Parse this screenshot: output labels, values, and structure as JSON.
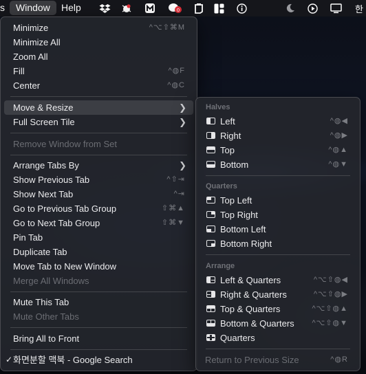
{
  "menubar": {
    "cut_item": "s",
    "window": "Window",
    "help": "Help",
    "ime": "한"
  },
  "window_menu": {
    "items": [
      {
        "label": "Minimize",
        "shortcut": "^⌥⇧⌘M"
      },
      {
        "label": "Minimize All",
        "shortcut": ""
      },
      {
        "label": "Zoom All",
        "shortcut": ""
      },
      {
        "label": "Fill",
        "shortcut": "^◍F"
      },
      {
        "label": "Center",
        "shortcut": "^◍C"
      },
      {
        "label": "Move & Resize",
        "shortcut": ""
      },
      {
        "label": "Full Screen Tile",
        "shortcut": ""
      },
      {
        "label": "Remove Window from Set",
        "shortcut": ""
      },
      {
        "label": "Arrange Tabs By",
        "shortcut": ""
      },
      {
        "label": "Show Previous Tab",
        "shortcut": "^⇧⇥"
      },
      {
        "label": "Show Next Tab",
        "shortcut": "^⇥"
      },
      {
        "label": "Go to Previous Tab Group",
        "shortcut": "⇧⌘▲"
      },
      {
        "label": "Go to Next Tab Group",
        "shortcut": "⇧⌘▼"
      },
      {
        "label": "Pin Tab",
        "shortcut": ""
      },
      {
        "label": "Duplicate Tab",
        "shortcut": ""
      },
      {
        "label": "Move Tab to New Window",
        "shortcut": ""
      },
      {
        "label": "Merge All Windows",
        "shortcut": ""
      },
      {
        "label": "Mute This Tab",
        "shortcut": ""
      },
      {
        "label": "Mute Other Tabs",
        "shortcut": ""
      },
      {
        "label": "Bring All to Front",
        "shortcut": ""
      },
      {
        "label": "화면분할 맥북 - Google Search",
        "shortcut": ""
      }
    ]
  },
  "submenu": {
    "halves_header": "Halves",
    "quarters_header": "Quarters",
    "arrange_header": "Arrange",
    "halves": [
      {
        "label": "Left",
        "shortcut": "^◍◀"
      },
      {
        "label": "Right",
        "shortcut": "^◍▶"
      },
      {
        "label": "Top",
        "shortcut": "^◍▲"
      },
      {
        "label": "Bottom",
        "shortcut": "^◍▼"
      }
    ],
    "quarters": [
      {
        "label": "Top Left"
      },
      {
        "label": "Top Right"
      },
      {
        "label": "Bottom Left"
      },
      {
        "label": "Bottom Right"
      }
    ],
    "arrange": [
      {
        "label": "Left & Quarters",
        "shortcut": "^⌥⇧◍◀"
      },
      {
        "label": "Right & Quarters",
        "shortcut": "^⌥⇧◍▶"
      },
      {
        "label": "Top & Quarters",
        "shortcut": "^⌥⇧◍▲"
      },
      {
        "label": "Bottom & Quarters",
        "shortcut": "^⌥⇧◍▼"
      },
      {
        "label": "Quarters",
        "shortcut": ""
      }
    ],
    "return": {
      "label": "Return to Previous Size",
      "shortcut": "^◍R"
    }
  }
}
